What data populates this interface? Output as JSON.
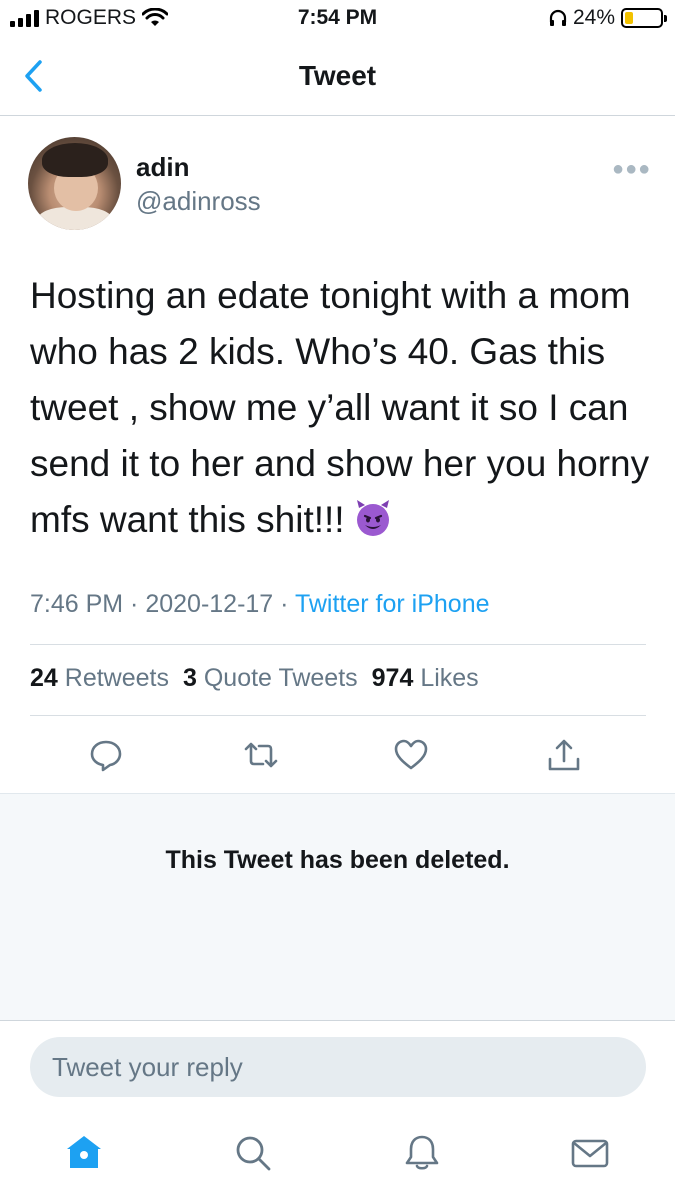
{
  "status_bar": {
    "carrier": "ROGERS",
    "time": "7:54 PM",
    "battery_percent": "24%",
    "battery_level": 0.24,
    "icons": [
      "signal-icon",
      "wifi-icon",
      "headphones-icon",
      "battery-icon"
    ]
  },
  "nav": {
    "title": "Tweet",
    "back_icon": "chevron-left-icon"
  },
  "tweet": {
    "author_name": "adin",
    "author_handle": "@adinross",
    "text": "Hosting an edate tonight with a mom who has 2 kids. Who’s 40. Gas this tweet , show me y’all want it so I can send it to her and show her you horny mfs want this shit!!!",
    "emoji": "smiling-devil-emoji",
    "time": "7:46 PM",
    "sep1": " · ",
    "date": "2020-12-17",
    "sep2": " · ",
    "source": "Twitter for iPhone",
    "stats": {
      "retweets_count": "24",
      "retweets_label": "Retweets",
      "quotes_count": "3",
      "quotes_label": "Quote Tweets",
      "likes_count": "974",
      "likes_label": "Likes"
    },
    "actions": [
      "reply-icon",
      "retweet-icon",
      "like-icon",
      "share-icon"
    ]
  },
  "deleted_notice": "This Tweet has been deleted.",
  "reply": {
    "placeholder": "Tweet your reply"
  },
  "tab_bar": {
    "tabs": [
      "home-icon",
      "search-icon",
      "notifications-icon",
      "messages-icon"
    ],
    "active": "home-icon"
  },
  "colors": {
    "accent": "#1da1f2",
    "secondary_text": "#657786",
    "panel_bg": "#f5f8fa"
  }
}
